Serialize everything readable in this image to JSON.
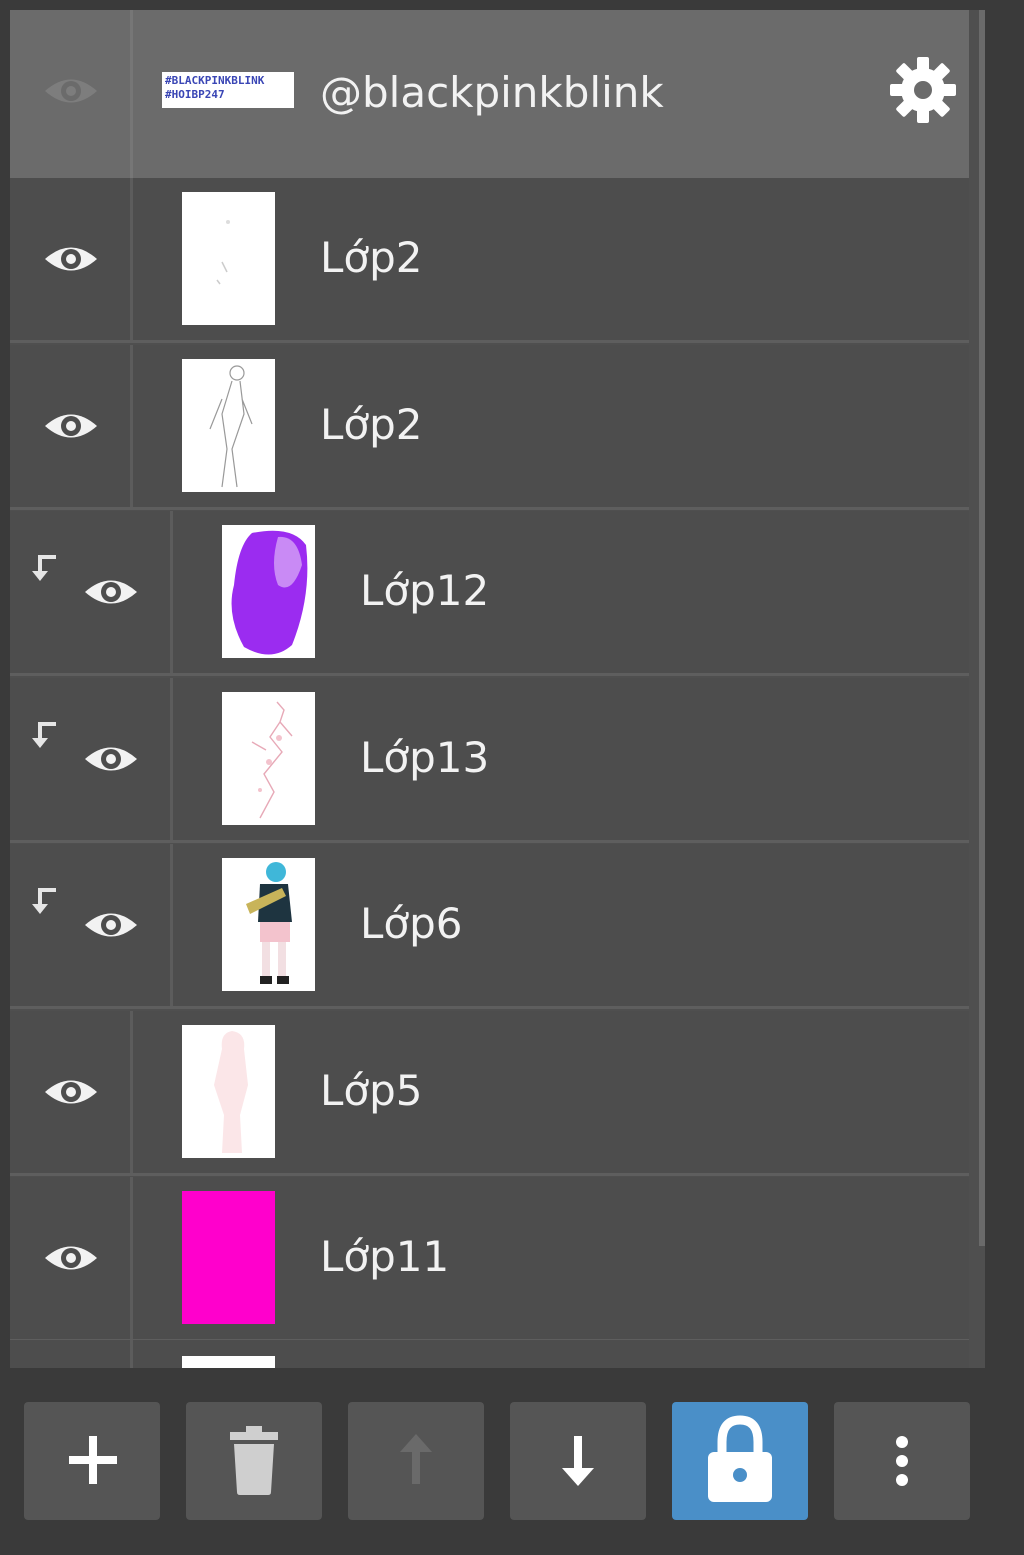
{
  "header_layer": {
    "name": "@blackpinkblink",
    "watermark_lines": [
      "#BLACKPINKBLINK",
      "#HOIBP247"
    ]
  },
  "layers": [
    {
      "name": "Lớp2",
      "clipped": false,
      "visible": true,
      "thumb": "sketch-light"
    },
    {
      "name": "Lớp2",
      "clipped": false,
      "visible": true,
      "thumb": "sketch-figure"
    },
    {
      "name": "Lớp12",
      "clipped": true,
      "visible": true,
      "thumb": "purple-blob"
    },
    {
      "name": "Lớp13",
      "clipped": true,
      "visible": true,
      "thumb": "pink-sketch"
    },
    {
      "name": "Lớp6",
      "clipped": true,
      "visible": true,
      "thumb": "colored-character"
    },
    {
      "name": "Lớp5",
      "clipped": false,
      "visible": true,
      "thumb": "pale-figure"
    },
    {
      "name": "Lớp11",
      "clipped": false,
      "visible": true,
      "thumb": "magenta-fill"
    }
  ],
  "toolbar": {
    "buttons": [
      {
        "name": "add",
        "icon": "plus-icon"
      },
      {
        "name": "delete",
        "icon": "trash-icon"
      },
      {
        "name": "move-up",
        "icon": "arrow-up-icon",
        "disabled": true
      },
      {
        "name": "move-down",
        "icon": "arrow-down-icon"
      },
      {
        "name": "lock",
        "icon": "lock-icon",
        "active": true
      },
      {
        "name": "more",
        "icon": "more-vertical-icon"
      }
    ]
  },
  "colors": {
    "accent": "#4a8fc8",
    "magenta": "#ff00cc",
    "purple": "#9b2cf0"
  }
}
